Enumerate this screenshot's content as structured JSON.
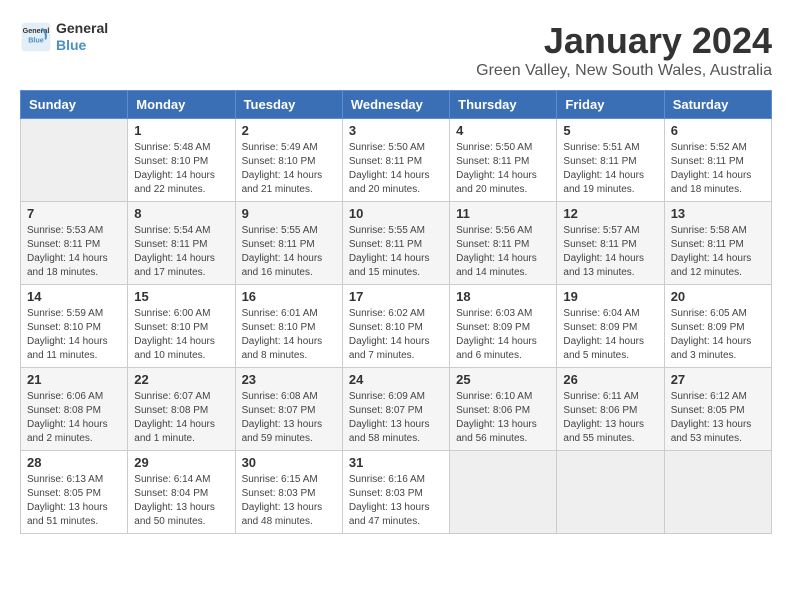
{
  "logo": {
    "line1": "General",
    "line2": "Blue"
  },
  "title": "January 2024",
  "subtitle": "Green Valley, New South Wales, Australia",
  "headers": [
    "Sunday",
    "Monday",
    "Tuesday",
    "Wednesday",
    "Thursday",
    "Friday",
    "Saturday"
  ],
  "weeks": [
    [
      {
        "day": "",
        "info": ""
      },
      {
        "day": "1",
        "info": "Sunrise: 5:48 AM\nSunset: 8:10 PM\nDaylight: 14 hours\nand 22 minutes."
      },
      {
        "day": "2",
        "info": "Sunrise: 5:49 AM\nSunset: 8:10 PM\nDaylight: 14 hours\nand 21 minutes."
      },
      {
        "day": "3",
        "info": "Sunrise: 5:50 AM\nSunset: 8:11 PM\nDaylight: 14 hours\nand 20 minutes."
      },
      {
        "day": "4",
        "info": "Sunrise: 5:50 AM\nSunset: 8:11 PM\nDaylight: 14 hours\nand 20 minutes."
      },
      {
        "day": "5",
        "info": "Sunrise: 5:51 AM\nSunset: 8:11 PM\nDaylight: 14 hours\nand 19 minutes."
      },
      {
        "day": "6",
        "info": "Sunrise: 5:52 AM\nSunset: 8:11 PM\nDaylight: 14 hours\nand 18 minutes."
      }
    ],
    [
      {
        "day": "7",
        "info": "Sunrise: 5:53 AM\nSunset: 8:11 PM\nDaylight: 14 hours\nand 18 minutes."
      },
      {
        "day": "8",
        "info": "Sunrise: 5:54 AM\nSunset: 8:11 PM\nDaylight: 14 hours\nand 17 minutes."
      },
      {
        "day": "9",
        "info": "Sunrise: 5:55 AM\nSunset: 8:11 PM\nDaylight: 14 hours\nand 16 minutes."
      },
      {
        "day": "10",
        "info": "Sunrise: 5:55 AM\nSunset: 8:11 PM\nDaylight: 14 hours\nand 15 minutes."
      },
      {
        "day": "11",
        "info": "Sunrise: 5:56 AM\nSunset: 8:11 PM\nDaylight: 14 hours\nand 14 minutes."
      },
      {
        "day": "12",
        "info": "Sunrise: 5:57 AM\nSunset: 8:11 PM\nDaylight: 14 hours\nand 13 minutes."
      },
      {
        "day": "13",
        "info": "Sunrise: 5:58 AM\nSunset: 8:11 PM\nDaylight: 14 hours\nand 12 minutes."
      }
    ],
    [
      {
        "day": "14",
        "info": "Sunrise: 5:59 AM\nSunset: 8:10 PM\nDaylight: 14 hours\nand 11 minutes."
      },
      {
        "day": "15",
        "info": "Sunrise: 6:00 AM\nSunset: 8:10 PM\nDaylight: 14 hours\nand 10 minutes."
      },
      {
        "day": "16",
        "info": "Sunrise: 6:01 AM\nSunset: 8:10 PM\nDaylight: 14 hours\nand 8 minutes."
      },
      {
        "day": "17",
        "info": "Sunrise: 6:02 AM\nSunset: 8:10 PM\nDaylight: 14 hours\nand 7 minutes."
      },
      {
        "day": "18",
        "info": "Sunrise: 6:03 AM\nSunset: 8:09 PM\nDaylight: 14 hours\nand 6 minutes."
      },
      {
        "day": "19",
        "info": "Sunrise: 6:04 AM\nSunset: 8:09 PM\nDaylight: 14 hours\nand 5 minutes."
      },
      {
        "day": "20",
        "info": "Sunrise: 6:05 AM\nSunset: 8:09 PM\nDaylight: 14 hours\nand 3 minutes."
      }
    ],
    [
      {
        "day": "21",
        "info": "Sunrise: 6:06 AM\nSunset: 8:08 PM\nDaylight: 14 hours\nand 2 minutes."
      },
      {
        "day": "22",
        "info": "Sunrise: 6:07 AM\nSunset: 8:08 PM\nDaylight: 14 hours\nand 1 minute."
      },
      {
        "day": "23",
        "info": "Sunrise: 6:08 AM\nSunset: 8:07 PM\nDaylight: 13 hours\nand 59 minutes."
      },
      {
        "day": "24",
        "info": "Sunrise: 6:09 AM\nSunset: 8:07 PM\nDaylight: 13 hours\nand 58 minutes."
      },
      {
        "day": "25",
        "info": "Sunrise: 6:10 AM\nSunset: 8:06 PM\nDaylight: 13 hours\nand 56 minutes."
      },
      {
        "day": "26",
        "info": "Sunrise: 6:11 AM\nSunset: 8:06 PM\nDaylight: 13 hours\nand 55 minutes."
      },
      {
        "day": "27",
        "info": "Sunrise: 6:12 AM\nSunset: 8:05 PM\nDaylight: 13 hours\nand 53 minutes."
      }
    ],
    [
      {
        "day": "28",
        "info": "Sunrise: 6:13 AM\nSunset: 8:05 PM\nDaylight: 13 hours\nand 51 minutes."
      },
      {
        "day": "29",
        "info": "Sunrise: 6:14 AM\nSunset: 8:04 PM\nDaylight: 13 hours\nand 50 minutes."
      },
      {
        "day": "30",
        "info": "Sunrise: 6:15 AM\nSunset: 8:03 PM\nDaylight: 13 hours\nand 48 minutes."
      },
      {
        "day": "31",
        "info": "Sunrise: 6:16 AM\nSunset: 8:03 PM\nDaylight: 13 hours\nand 47 minutes."
      },
      {
        "day": "",
        "info": ""
      },
      {
        "day": "",
        "info": ""
      },
      {
        "day": "",
        "info": ""
      }
    ]
  ]
}
